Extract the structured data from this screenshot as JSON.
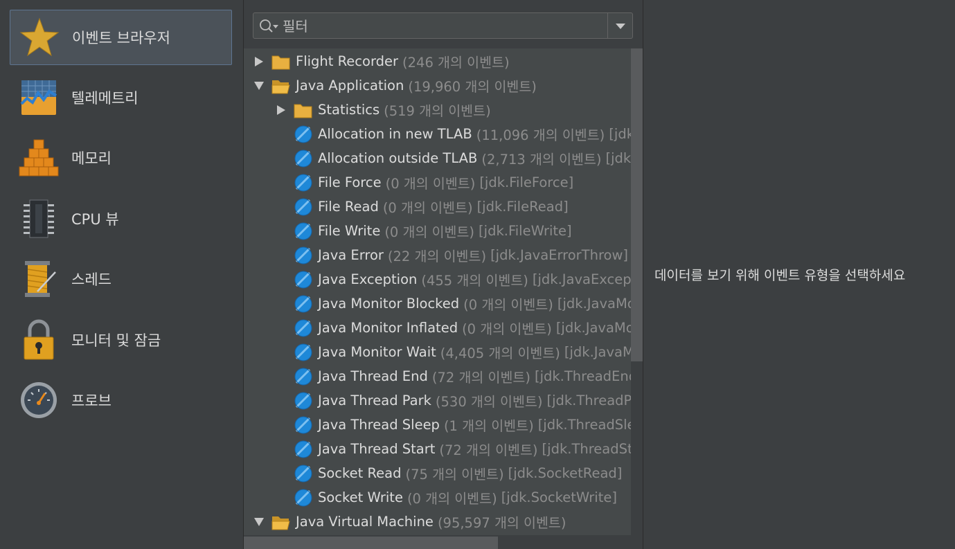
{
  "sidebar": {
    "items": [
      {
        "label": "이벤트 브라우저",
        "icon": "star-icon",
        "active": true
      },
      {
        "label": "텔레메트리",
        "icon": "telemetry-chart-icon"
      },
      {
        "label": "메모리",
        "icon": "memory-blocks-icon"
      },
      {
        "label": "CPU 뷰",
        "icon": "cpu-chip-icon"
      },
      {
        "label": "스레드",
        "icon": "thread-spool-icon"
      },
      {
        "label": "모니터 및 잠금",
        "icon": "padlock-icon"
      },
      {
        "label": "프로브",
        "icon": "gauge-icon"
      }
    ]
  },
  "filter": {
    "placeholder": "필터",
    "icons": [
      "search-icon",
      "chevron-down-icon"
    ]
  },
  "tree": {
    "rows": [
      {
        "level": 0,
        "expander": "collapsed",
        "icon": "folder",
        "name": "Flight Recorder",
        "count": "(246 개의 이벤트)",
        "type": ""
      },
      {
        "level": 0,
        "expander": "expanded",
        "icon": "folder-open",
        "name": "Java Application",
        "count": "(19,960 개의 이벤트)",
        "type": ""
      },
      {
        "level": 1,
        "expander": "collapsed",
        "icon": "folder",
        "name": "Statistics",
        "count": "(519 개의 이벤트)",
        "type": ""
      },
      {
        "level": 1,
        "expander": "none",
        "icon": "event",
        "name": "Allocation in new TLAB",
        "count": "(11,096 개의 이벤트)",
        "type": "[jdk.ObjectAllocationInNewTLAB]"
      },
      {
        "level": 1,
        "expander": "none",
        "icon": "event",
        "name": "Allocation outside TLAB",
        "count": "(2,713 개의 이벤트)",
        "type": "[jdk.ObjectAllocationOutsideTLAB]"
      },
      {
        "level": 1,
        "expander": "none",
        "icon": "event",
        "name": "File Force",
        "count": "(0 개의 이벤트)",
        "type": "[jdk.FileForce]"
      },
      {
        "level": 1,
        "expander": "none",
        "icon": "event",
        "name": "File Read",
        "count": "(0 개의 이벤트)",
        "type": "[jdk.FileRead]"
      },
      {
        "level": 1,
        "expander": "none",
        "icon": "event",
        "name": "File Write",
        "count": "(0 개의 이벤트)",
        "type": "[jdk.FileWrite]"
      },
      {
        "level": 1,
        "expander": "none",
        "icon": "event",
        "name": "Java Error",
        "count": "(22 개의 이벤트)",
        "type": "[jdk.JavaErrorThrow]"
      },
      {
        "level": 1,
        "expander": "none",
        "icon": "event",
        "name": "Java Exception",
        "count": "(455 개의 이벤트)",
        "type": "[jdk.JavaExceptionThrow]"
      },
      {
        "level": 1,
        "expander": "none",
        "icon": "event",
        "name": "Java Monitor Blocked",
        "count": "(0 개의 이벤트)",
        "type": "[jdk.JavaMonitorEnter]"
      },
      {
        "level": 1,
        "expander": "none",
        "icon": "event",
        "name": "Java Monitor Inflated",
        "count": "(0 개의 이벤트)",
        "type": "[jdk.JavaMonitorInflate]"
      },
      {
        "level": 1,
        "expander": "none",
        "icon": "event",
        "name": "Java Monitor Wait",
        "count": "(4,405 개의 이벤트)",
        "type": "[jdk.JavaMonitorWait]"
      },
      {
        "level": 1,
        "expander": "none",
        "icon": "event",
        "name": "Java Thread End",
        "count": "(72 개의 이벤트)",
        "type": "[jdk.ThreadEnd]"
      },
      {
        "level": 1,
        "expander": "none",
        "icon": "event",
        "name": "Java Thread Park",
        "count": "(530 개의 이벤트)",
        "type": "[jdk.ThreadPark]"
      },
      {
        "level": 1,
        "expander": "none",
        "icon": "event",
        "name": "Java Thread Sleep",
        "count": "(1 개의 이벤트)",
        "type": "[jdk.ThreadSleep]"
      },
      {
        "level": 1,
        "expander": "none",
        "icon": "event",
        "name": "Java Thread Start",
        "count": "(72 개의 이벤트)",
        "type": "[jdk.ThreadStart]"
      },
      {
        "level": 1,
        "expander": "none",
        "icon": "event",
        "name": "Socket Read",
        "count": "(75 개의 이벤트)",
        "type": "[jdk.SocketRead]"
      },
      {
        "level": 1,
        "expander": "none",
        "icon": "event",
        "name": "Socket Write",
        "count": "(0 개의 이벤트)",
        "type": "[jdk.SocketWrite]"
      },
      {
        "level": 0,
        "expander": "expanded",
        "icon": "folder-open",
        "name": "Java Virtual Machine",
        "count": "(95,597 개의 이벤트)",
        "type": ""
      }
    ]
  },
  "detail": {
    "message": "데이터를 보기 위해 이벤트 유형을 선택하세요"
  },
  "colors": {
    "background": "#3c3f41",
    "tree_background": "#45494a",
    "selected_border": "#5e7591",
    "folder": "#e8b040",
    "event_icon": "#1e88d8",
    "text": "#dcdcdc",
    "muted_text": "#8c8c8c"
  }
}
